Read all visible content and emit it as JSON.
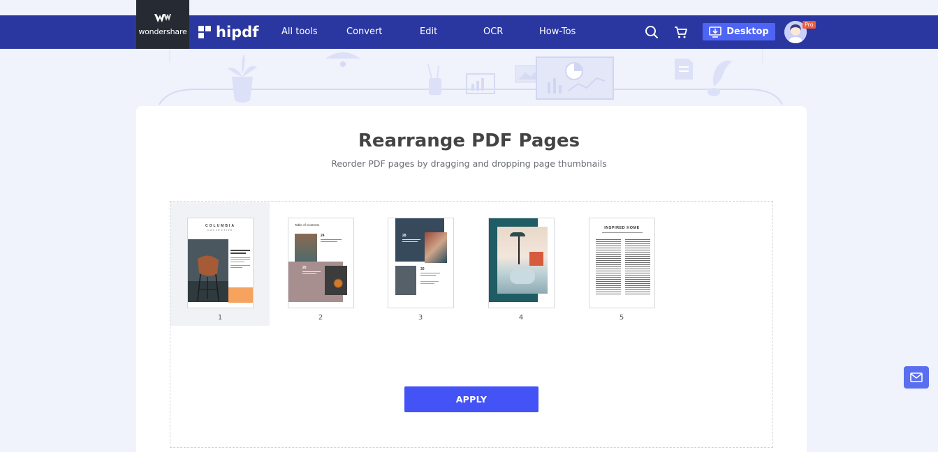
{
  "header": {
    "vendor_logo_text": "wondershare",
    "brand_name": "hipdf",
    "nav": [
      {
        "label": "All tools"
      },
      {
        "label": "Convert"
      },
      {
        "label": "Edit"
      },
      {
        "label": "OCR"
      },
      {
        "label": "How-Tos"
      }
    ],
    "desktop_button_label": "Desktop",
    "pro_badge": "Pro"
  },
  "main": {
    "title": "Rearrange PDF Pages",
    "subtitle": "Reorder PDF pages by dragging and dropping page thumbnails",
    "pages": [
      {
        "number": "1",
        "selected": true
      },
      {
        "number": "2",
        "selected": false
      },
      {
        "number": "3",
        "selected": false
      },
      {
        "number": "4",
        "selected": false
      },
      {
        "number": "5",
        "selected": false
      }
    ],
    "apply_label": "APPLY"
  },
  "thumb_text": {
    "p1_title": "COLUMBIA",
    "p1_sub": "COLLECTIVE",
    "p2_title": "Table of Contents",
    "p2_num_a": "24",
    "p2_num_b": "26",
    "p3_num_a": "28",
    "p3_num_b": "30",
    "p5_title": "INSPIRED HOME"
  },
  "colors": {
    "navbar": "#2b37a0",
    "accent": "#4353f5",
    "desktop_button": "#4e64f5",
    "pro_badge": "#ef5a3c"
  },
  "icons": [
    "search-icon",
    "cart-icon",
    "download-desktop-icon",
    "mail-icon"
  ]
}
